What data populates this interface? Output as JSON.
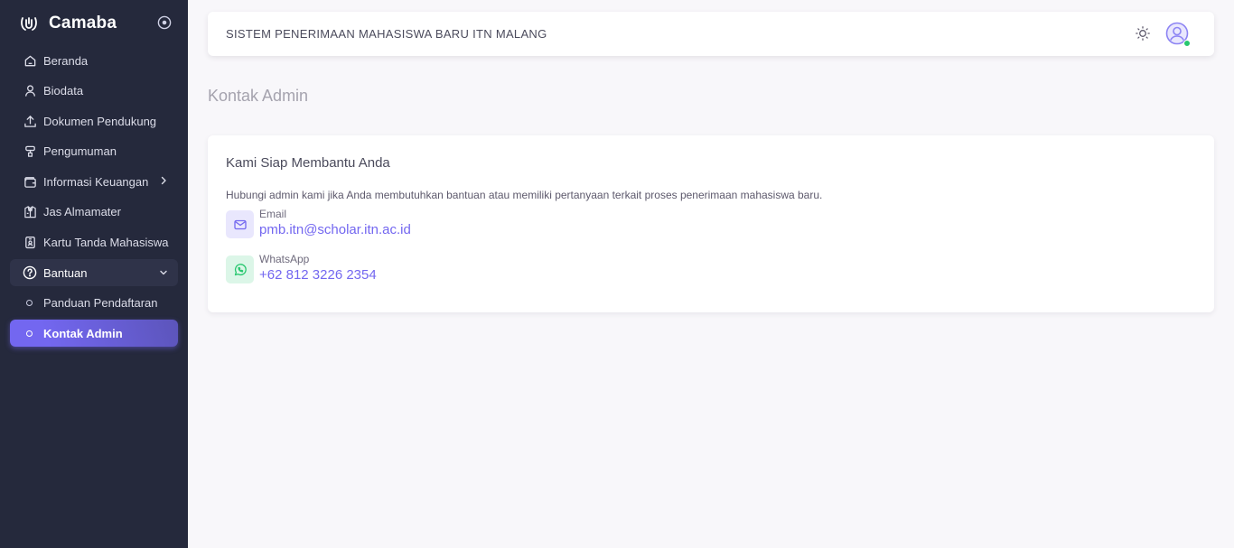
{
  "brand": {
    "name": "Camaba"
  },
  "sidebar": {
    "items": [
      {
        "label": "Beranda"
      },
      {
        "label": "Biodata"
      },
      {
        "label": "Dokumen Pendukung"
      },
      {
        "label": "Pengumuman"
      },
      {
        "label": "Informasi Keuangan"
      },
      {
        "label": "Jas Almamater"
      },
      {
        "label": "Kartu Tanda Mahasiswa"
      },
      {
        "label": "Bantuan"
      },
      {
        "label": "Panduan Pendaftaran"
      },
      {
        "label": "Kontak Admin"
      }
    ]
  },
  "navbar": {
    "title": "SISTEM PENERIMAAN MAHASISWA BARU ITN MALANG"
  },
  "page": {
    "title": "Kontak Admin"
  },
  "card": {
    "title": "Kami Siap Membantu Anda",
    "description": "Hubungi admin kami jika Anda membutuhkan bantuan atau memiliki pertanyaan terkait proses penerimaan mahasiswa baru.",
    "contacts": [
      {
        "label": "Email",
        "value": "pmb.itn@scholar.itn.ac.id"
      },
      {
        "label": "WhatsApp",
        "value": "+62 812 3226 2354"
      }
    ]
  },
  "colors": {
    "sidebar_bg": "#25293c",
    "accent": "#7367f0",
    "online": "#28c76f",
    "page_bg": "#f8f7fa"
  },
  "icons": {
    "brand": "camaba-logo-icon",
    "sidebar_toggle": "circle-dot-icon",
    "theme": "sun-icon",
    "avatar": "user-circle-icon",
    "email": "mail-icon",
    "whatsapp": "whatsapp-icon"
  }
}
